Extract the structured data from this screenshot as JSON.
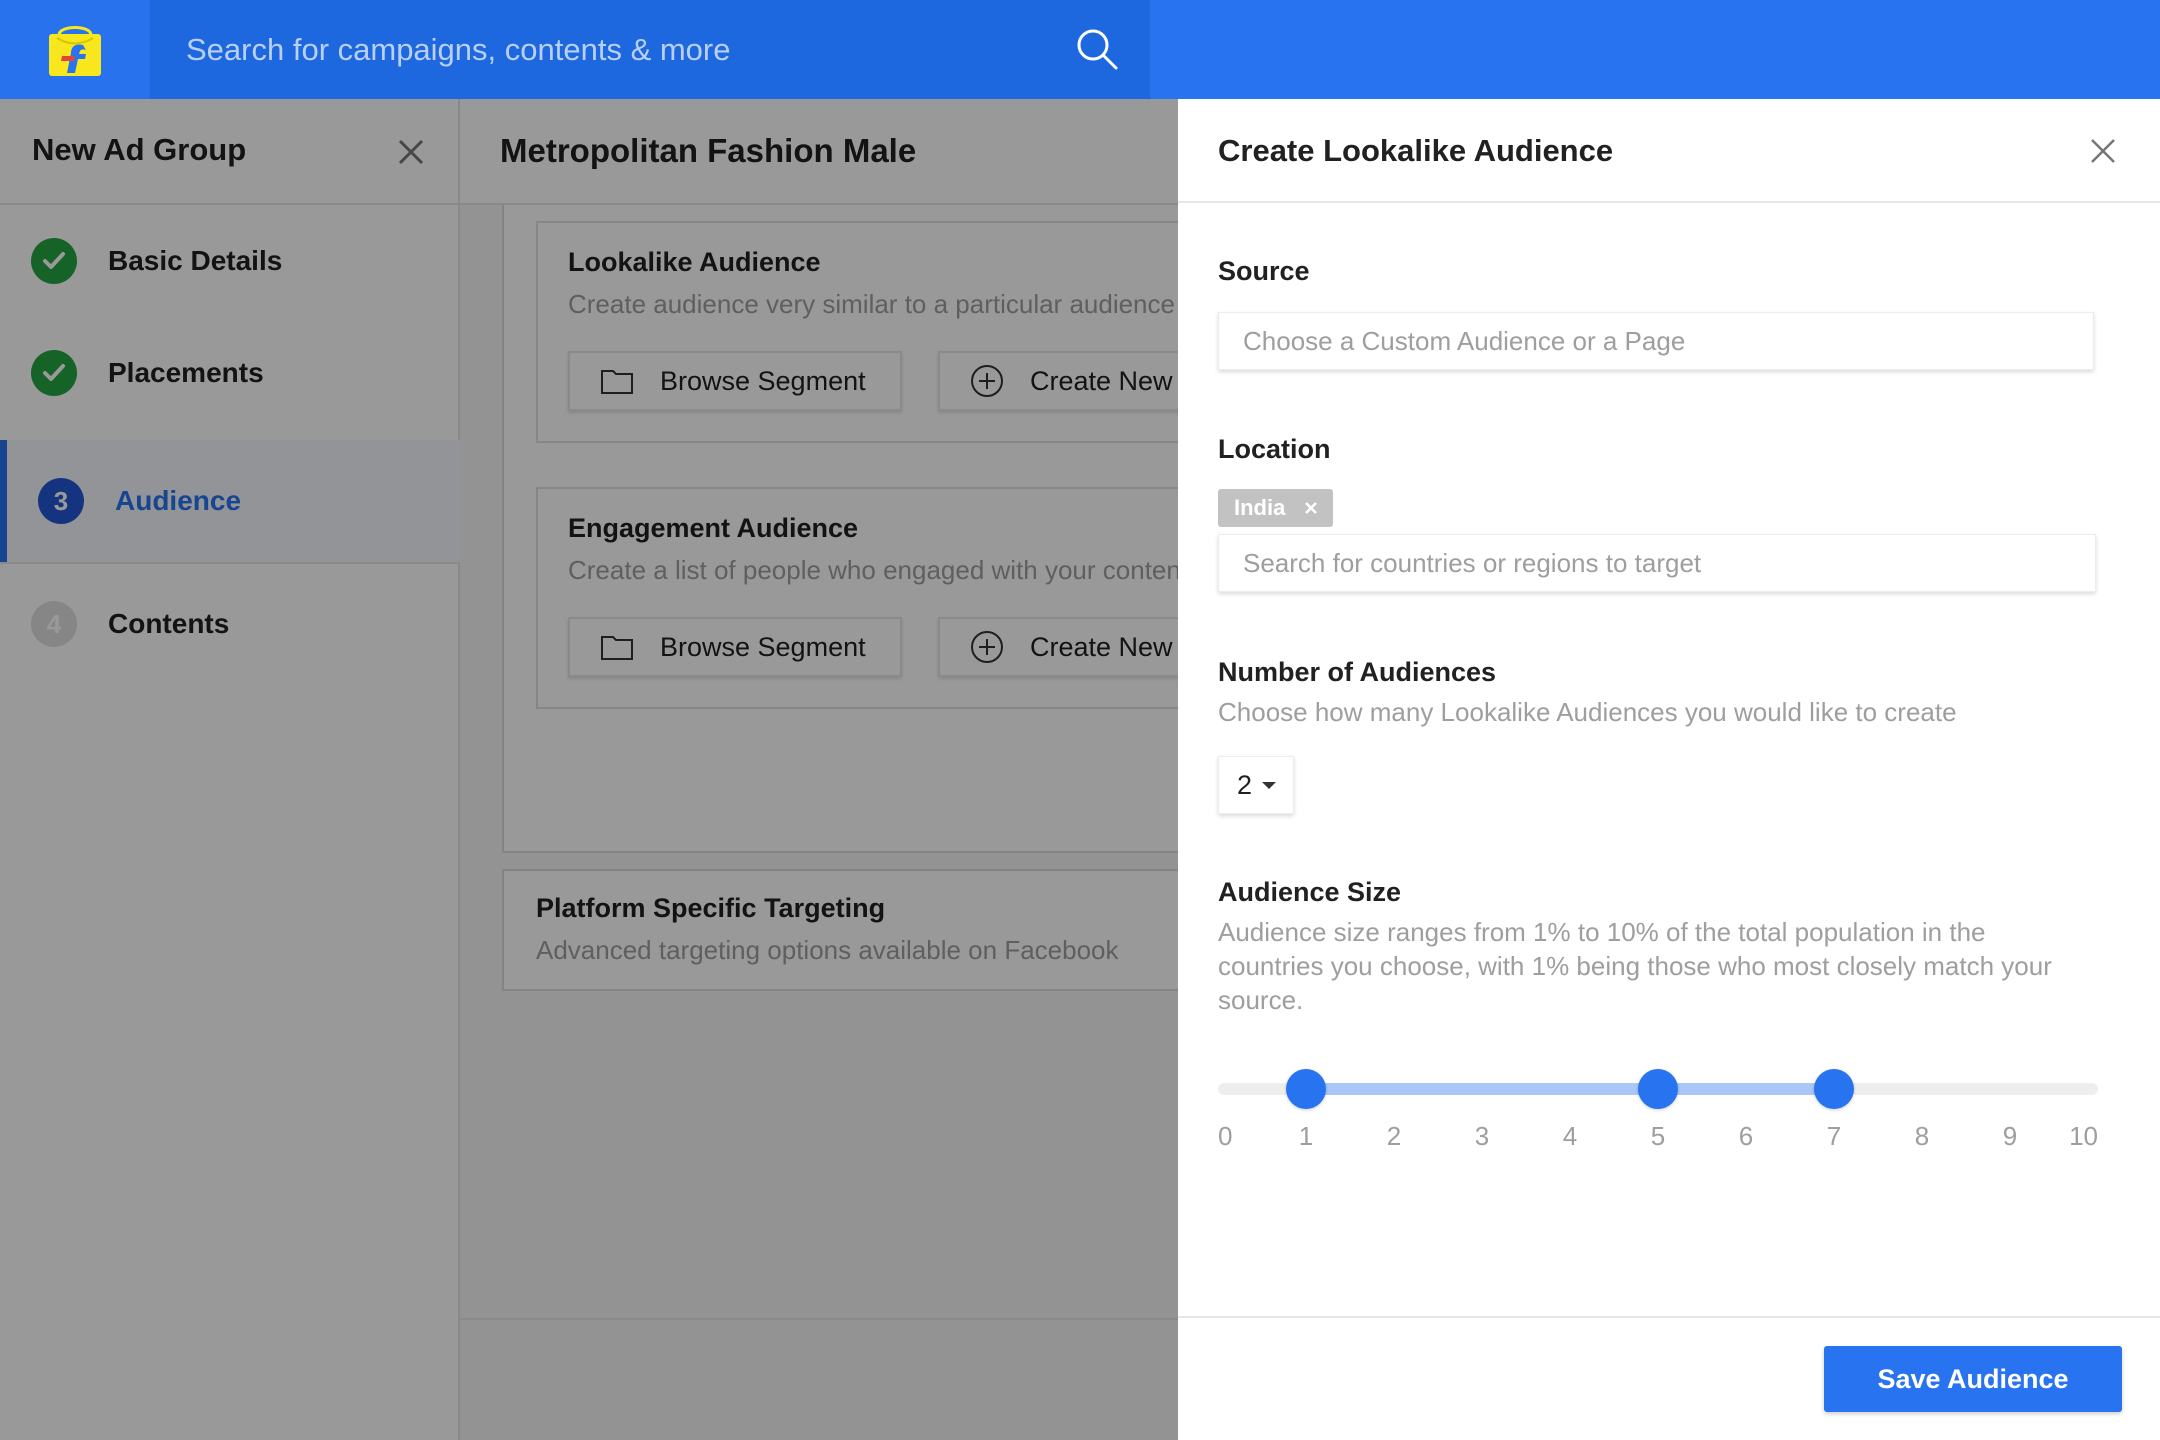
{
  "search": {
    "placeholder": "Search for campaigns, contents & more"
  },
  "sidebar": {
    "title": "New Ad Group",
    "steps": [
      {
        "label": "Basic Details",
        "state": "done"
      },
      {
        "label": "Placements",
        "state": "done"
      },
      {
        "number": "3",
        "label": "Audience",
        "state": "active"
      },
      {
        "number": "4",
        "label": "Contents",
        "state": "todo"
      }
    ]
  },
  "main": {
    "title": "Metropolitan Fashion Male",
    "cards": [
      {
        "title": "Lookalike Audience",
        "subtitle": "Create audience very similar to a particular audience",
        "browse_label": "Browse Segment",
        "create_label": "Create New"
      },
      {
        "title": "Engagement Audience",
        "subtitle": "Create a list of people who engaged with your content",
        "browse_label": "Browse Segment",
        "create_label": "Create New"
      }
    ],
    "platform": {
      "title": "Platform Specific Targeting",
      "subtitle": "Advanced targeting options available on Facebook"
    }
  },
  "modal": {
    "title": "Create Lookalike Audience",
    "source": {
      "label": "Source",
      "placeholder": "Choose a Custom Audience or a Page",
      "value": ""
    },
    "location": {
      "label": "Location",
      "chips": [
        "India"
      ],
      "placeholder": "Search for countries or regions to target"
    },
    "number_of_audiences": {
      "label": "Number of Audiences",
      "help": "Choose how many Lookalike Audiences you would like to create",
      "value": "2"
    },
    "audience_size": {
      "label": "Audience Size",
      "help": "Audience size ranges from 1% to 10% of the total population in the countries you choose, with 1% being those who most closely match your source.",
      "min": 0,
      "max": 10,
      "handles": [
        1,
        5,
        7
      ],
      "ticks": [
        "0",
        "1",
        "2",
        "3",
        "4",
        "5",
        "6",
        "7",
        "8",
        "9",
        "10"
      ]
    },
    "save_label": "Save Audience"
  },
  "colors": {
    "brand_blue": "#2874f0",
    "search_bg": "#1d67df",
    "success_green": "#26a541",
    "logo_yellow": "#f8e71c",
    "range_fill": "#a9c7f7"
  },
  "icons": {
    "logo": "flipkart-logo",
    "search": "search-icon",
    "close": "close-icon",
    "done": "check-icon",
    "folder": "folder-icon",
    "add": "plus-circle-icon",
    "caret": "caret-down-icon"
  }
}
